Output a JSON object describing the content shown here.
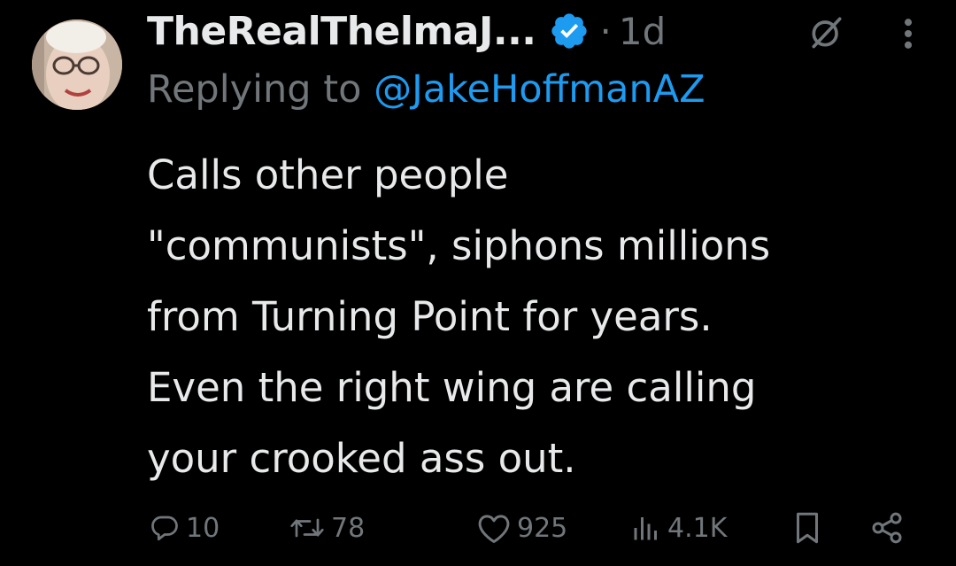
{
  "tweet": {
    "author_display_name": "TheRealThelmaJ...",
    "separator": "·",
    "timestamp": "1d",
    "reply_prefix": "Replying to",
    "reply_handle": "@JakeHoffmanAZ",
    "body_lines": [
      "Calls other people",
      "\"communists\", siphons millions",
      "from Turning Point for years.",
      "Even the right wing are calling",
      "your crooked ass out."
    ]
  },
  "actions": {
    "replies": "10",
    "reposts": "78",
    "likes": "925",
    "views": "4.1K"
  },
  "icons": {
    "verified": "verified-badge-icon",
    "grok": "grok-icon",
    "more": "more-vertical-icon",
    "reply": "reply-icon",
    "repost": "repost-icon",
    "like": "heart-icon",
    "views": "views-bars-icon",
    "bookmark": "bookmark-icon",
    "share": "share-icon"
  },
  "colors": {
    "background": "#000000",
    "text": "#e7e9ea",
    "muted": "#71767b",
    "accent": "#1d9bf0"
  }
}
